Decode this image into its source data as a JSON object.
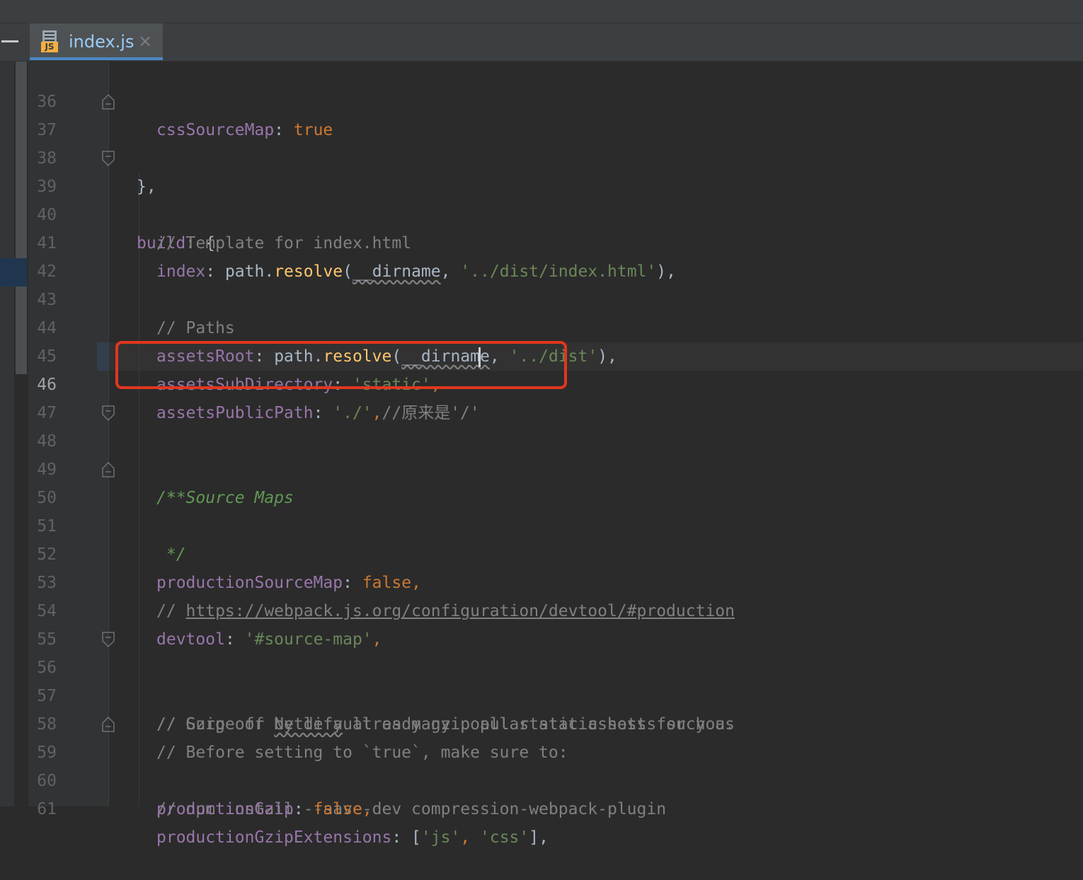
{
  "colors": {
    "editor_background": "#2b2b2b",
    "gutter_background": "#313335",
    "keyword": "#cc7832",
    "string": "#6a8759",
    "property": "#9876aa",
    "function": "#ffc66d",
    "comment": "#808080",
    "doc_comment": "#629755",
    "tab_accent": "#4a88c7",
    "highlight_box": "#e0371f"
  },
  "icons": {
    "file_type": "javascript-file-icon",
    "tab_close": "close-icon",
    "fold": "fold-marker-icon",
    "window": "minimize-icon"
  },
  "tab": {
    "filename": "index.js",
    "badge": "JS",
    "close_glyph": "×"
  },
  "editor": {
    "current_line": 46,
    "lines": {
      "l36": {
        "number": "36",
        "key": "cssSourceMap",
        "colon": ": ",
        "value": "true"
      },
      "l37": {
        "number": "37",
        "text": "},"
      },
      "l38": {
        "number": "38"
      },
      "l39": {
        "number": "39",
        "key": "build",
        "rest": ": {"
      },
      "l40": {
        "number": "40",
        "comment": "// Template for index.html"
      },
      "l41": {
        "number": "41",
        "key": "index",
        "colon": ": ",
        "obj": "path.",
        "fn": "resolve",
        "open": "(",
        "sq": "__dirname",
        "comma": ", ",
        "str": "'../dist/index.html'",
        "close": "),"
      },
      "l42": {
        "number": "42"
      },
      "l43": {
        "number": "43",
        "comment": "// Paths"
      },
      "l44": {
        "number": "44",
        "key": "assetsRoot",
        "colon": ": ",
        "obj": "path.",
        "fn": "resolve",
        "open": "(",
        "sq": "__dirname",
        "comma": ", ",
        "str": "'../dist'",
        "close": "),"
      },
      "l45": {
        "number": "45",
        "key": "assetsSubDirectory",
        "colon": ": ",
        "str": "'static'",
        "punct": ","
      },
      "l46": {
        "number": "46",
        "key": "assetsPublicPath",
        "colon": ": ",
        "str": "'./'",
        "punct": ",",
        "comment": "//原来是'/'"
      },
      "l47": {
        "number": "47"
      },
      "l48": {
        "number": "48",
        "doc": "/**"
      },
      "l49": {
        "number": "49",
        "doc": " * Source Maps"
      },
      "l50": {
        "number": "50",
        "doc": " */"
      },
      "l51": {
        "number": "51"
      },
      "l52": {
        "number": "52",
        "key": "productionSourceMap",
        "colon": ": ",
        "value": "false",
        "punct": ","
      },
      "l53": {
        "number": "53",
        "comment_prefix": "// ",
        "url": "https://webpack.js.org/configuration/devtool/#production"
      },
      "l54": {
        "number": "54",
        "key": "devtool",
        "colon": ": ",
        "str": "'#source-map'",
        "punct": ","
      },
      "l55": {
        "number": "55"
      },
      "l56": {
        "number": "56",
        "comment": "// Gzip off by default as many popular static hosts such as"
      },
      "l57": {
        "number": "57",
        "comment_a": "// Surge or ",
        "sq": "Netlify",
        "comment_b": " already gzip all static assets for you."
      },
      "l58": {
        "number": "58",
        "comment": "// Before setting to `true`, make sure to:"
      },
      "l59": {
        "number": "59",
        "comment": "// npm install --save-dev compression-webpack-plugin"
      },
      "l60": {
        "number": "60",
        "key": "productionGzip",
        "colon": ": ",
        "value": "false",
        "punct": ","
      },
      "l61": {
        "number": "61",
        "key": "productionGzipExtensions",
        "colon": ": ",
        "open": "[",
        "str1": "'js'",
        "comma": ", ",
        "str2": "'css'",
        "close": "],"
      }
    }
  }
}
